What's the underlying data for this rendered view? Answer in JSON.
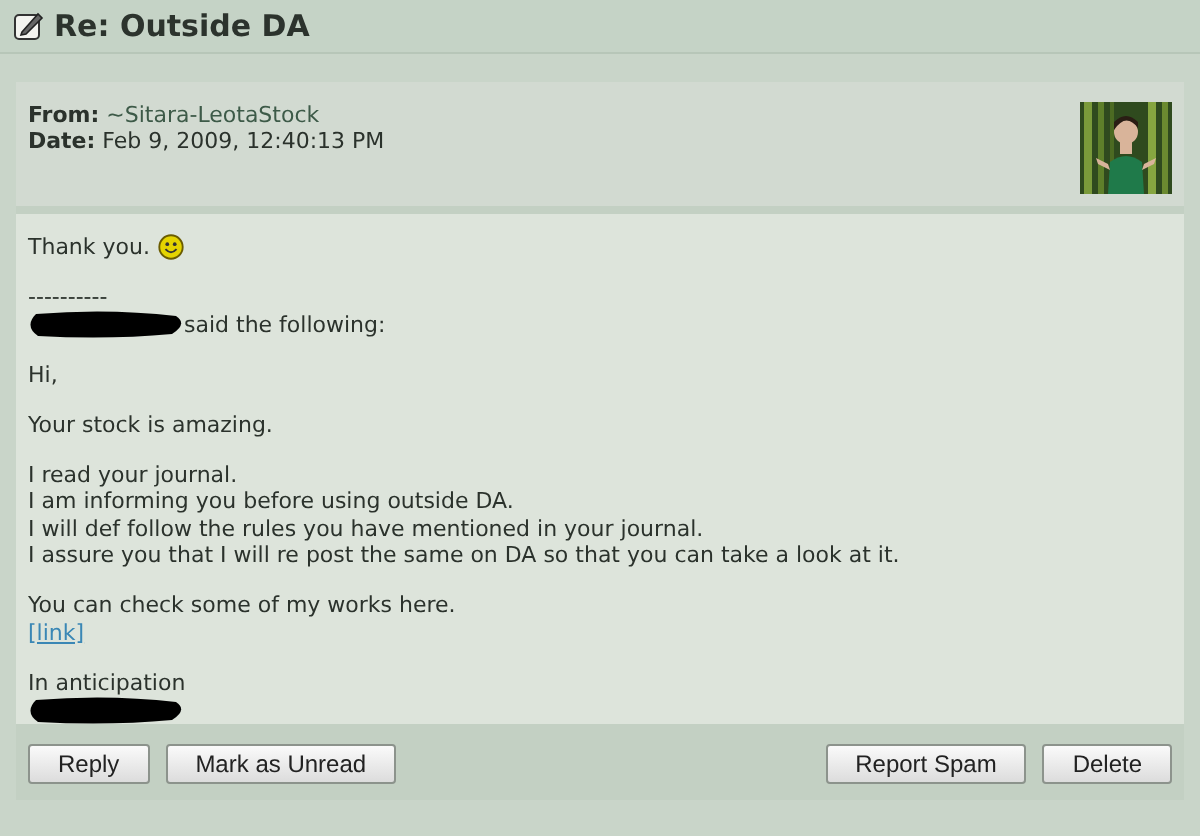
{
  "title": "Re: Outside DA",
  "header": {
    "from_label": "From:",
    "from": "~Sitara-LeotaStock",
    "date_label": "Date:",
    "date": "Feb 9, 2009, 12:40:13 PM"
  },
  "body": [
    {
      "kind": "smiley_text",
      "text": "Thank you."
    },
    {
      "kind": "gap"
    },
    {
      "kind": "text",
      "text": "----------"
    },
    {
      "kind": "redacted",
      "text": "said the following:"
    },
    {
      "kind": "gap"
    },
    {
      "kind": "text",
      "text": "Hi,"
    },
    {
      "kind": "gap"
    },
    {
      "kind": "text",
      "text": "Your stock is amazing."
    },
    {
      "kind": "gap"
    },
    {
      "kind": "text",
      "text": "I read your journal."
    },
    {
      "kind": "text",
      "text": "I am informing you before using outside DA."
    },
    {
      "kind": "text",
      "text": "I will def follow the rules you have mentioned in your journal."
    },
    {
      "kind": "text",
      "text": "I assure you that I will re post the same on DA so that you can take a look at it."
    },
    {
      "kind": "gap"
    },
    {
      "kind": "text",
      "text": "You can check some of my works here."
    },
    {
      "kind": "link",
      "text": "[link]"
    },
    {
      "kind": "gap"
    },
    {
      "kind": "text",
      "text": "In anticipation"
    },
    {
      "kind": "redacted"
    }
  ],
  "buttons_left": [
    "Reply",
    "Mark as Unread"
  ],
  "buttons_right": [
    "Report Spam",
    "Delete"
  ]
}
